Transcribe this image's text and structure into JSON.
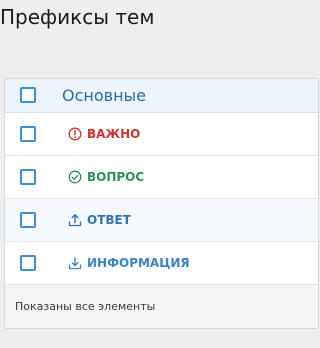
{
  "page": {
    "title": "Префиксы тем"
  },
  "group": {
    "label": "Основные"
  },
  "prefixes": [
    {
      "label": "ВАЖНО",
      "icon": "exclamation-circle-icon",
      "color": "#d0322f"
    },
    {
      "label": "ВОПРОС",
      "icon": "check-circle-icon",
      "color": "#2f8f58"
    },
    {
      "label": "ОТВЕТ",
      "icon": "upload-tray-icon",
      "color": "#2f72b1"
    },
    {
      "label": "ИНФОРМАЦИЯ",
      "icon": "download-tray-icon",
      "color": "#3c84c6"
    }
  ],
  "footer": {
    "status": "Показаны все элементы"
  },
  "colors": {
    "checkbox_border": "#3d8ed8",
    "header_bg": "#edf4fb",
    "group_label": "#2d6aa3"
  }
}
